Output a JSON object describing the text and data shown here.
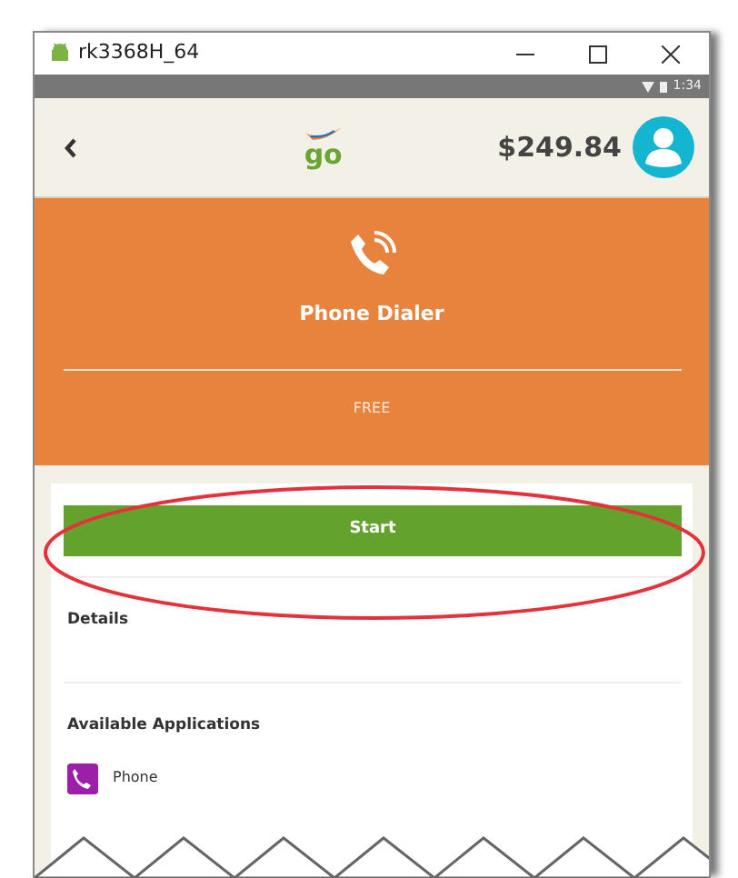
{
  "window": {
    "title": "rk3368H_64"
  },
  "status_bar": {
    "time": "1:34"
  },
  "header": {
    "logo_text": "go",
    "balance": "$249.84"
  },
  "app": {
    "name": "Phone Dialer",
    "price": "FREE"
  },
  "start_button": {
    "label": "Start"
  },
  "sections": [
    {
      "kind": "text",
      "title": "Details"
    },
    {
      "kind": "apps",
      "title": "Available Applications",
      "apps": [
        {
          "name": "Phone"
        }
      ]
    }
  ]
}
